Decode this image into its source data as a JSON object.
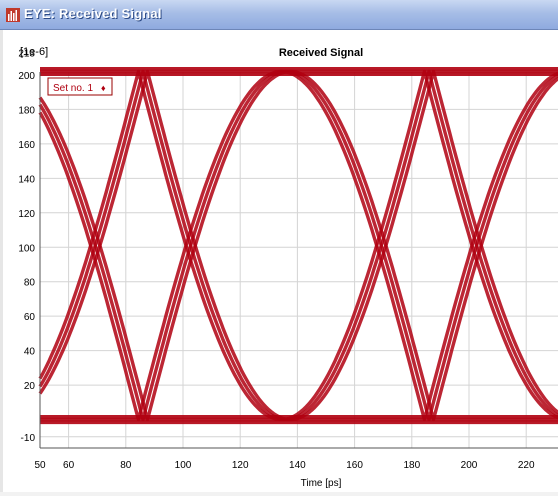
{
  "window": {
    "title": "EYE: Received Signal"
  },
  "chart": {
    "title": "Received Signal",
    "y_scale": "[1e-6]",
    "xlabel": "Time [ps]",
    "legend_label": "Set no. 1",
    "legend_marker": "♦"
  },
  "chart_data": {
    "type": "line",
    "title": "Received Signal",
    "xlabel": "Time [ps]",
    "ylabel": "",
    "y_multiplier": "[1e-6]",
    "xlim": [
      50,
      233
    ],
    "ylim": [
      -10,
      213
    ],
    "x_ticks": [
      50,
      60,
      80,
      100,
      120,
      140,
      160,
      180,
      200,
      220
    ],
    "y_ticks": [
      -10,
      20,
      40,
      60,
      80,
      100,
      120,
      140,
      160,
      180,
      200,
      213
    ],
    "grid": true,
    "legend_position": "top-left",
    "series": [
      {
        "name": "Set no. 1",
        "color": "#b00010",
        "eye_period_ps": 100,
        "crossing_x_ps": 136,
        "crossing_y": 101,
        "high_level": 202,
        "low_level": 0
      }
    ]
  }
}
